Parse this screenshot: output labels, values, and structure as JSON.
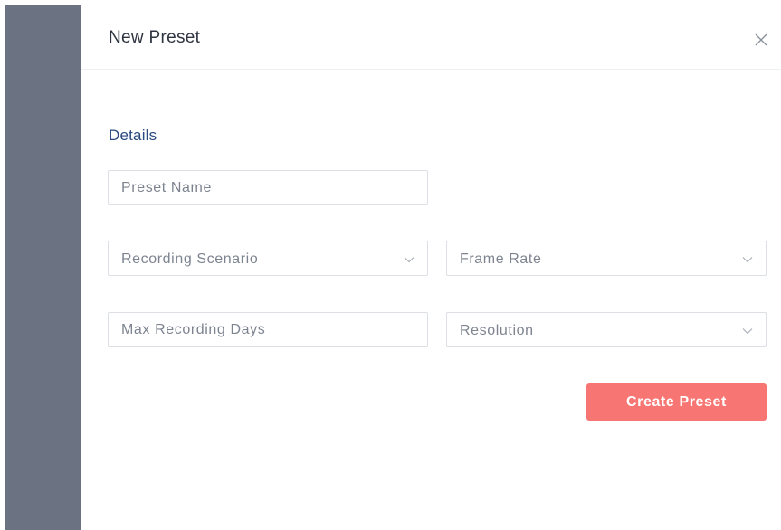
{
  "dialog": {
    "title": "New Preset",
    "close_icon": "close-icon"
  },
  "details": {
    "section_title": "Details",
    "preset_name": {
      "placeholder": "Preset Name",
      "value": ""
    },
    "recording_scenario": {
      "placeholder": "Recording Scenario",
      "value": ""
    },
    "frame_rate": {
      "placeholder": "Frame Rate",
      "value": ""
    },
    "max_recording_days": {
      "placeholder": "Max Recording Days",
      "value": ""
    },
    "resolution": {
      "placeholder": "Resolution",
      "value": ""
    }
  },
  "actions": {
    "create_label": "Create Preset"
  },
  "colors": {
    "backdrop": "#6b7281",
    "accent_title": "#2b4a80",
    "create_button": "#f77572"
  }
}
